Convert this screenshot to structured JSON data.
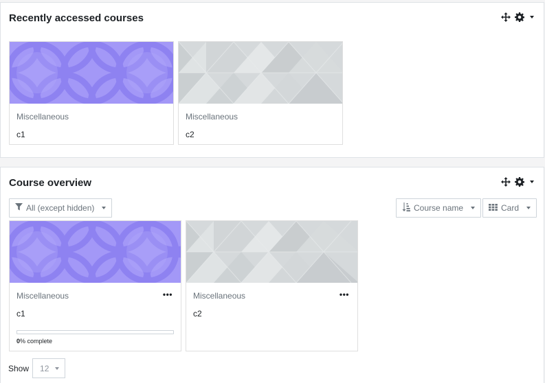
{
  "recent": {
    "title": "Recently accessed courses",
    "courses": [
      {
        "category": "Miscellaneous",
        "name": "c1",
        "pattern": "circles",
        "color": "#a398f7"
      },
      {
        "category": "Miscellaneous",
        "name": "c2",
        "pattern": "triangles",
        "color": "#cfd4d6"
      }
    ]
  },
  "overview": {
    "title": "Course overview",
    "filter_label": "All (except hidden)",
    "sort_label": "Course name",
    "view_label": "Card",
    "courses": [
      {
        "category": "Miscellaneous",
        "name": "c1",
        "menu": "•••",
        "progress_value": "0",
        "progress_suffix": "% complete",
        "progress": 0,
        "pattern": "circles"
      },
      {
        "category": "Miscellaneous",
        "name": "c2",
        "menu": "•••",
        "pattern": "triangles"
      }
    ],
    "show_label": "Show",
    "show_value": "12"
  },
  "icons": {
    "move": "move-icon",
    "gear": "gear-icon",
    "filter": "filter-icon",
    "sort": "sort-icon",
    "grid": "grid-icon"
  },
  "colors": {
    "circle_bg": "#a398f7",
    "triangle_bg": "#d5d9db"
  }
}
